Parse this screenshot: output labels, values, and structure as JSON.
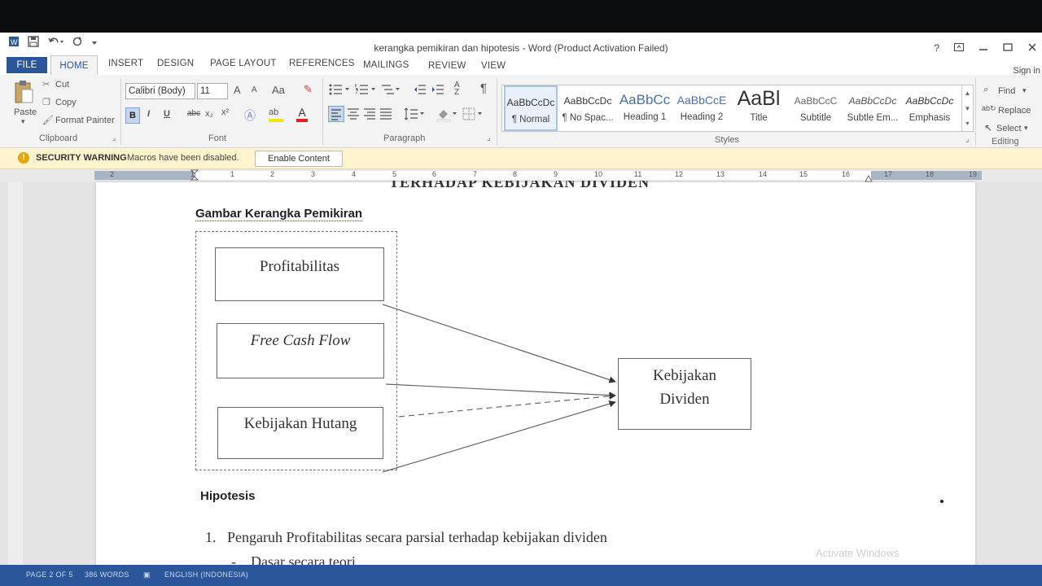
{
  "window": {
    "title": "kerangka pemikiran dan hipotesis - Word (Product Activation Failed)",
    "help": "?",
    "signin": "Sign in"
  },
  "tabs": [
    "FILE",
    "HOME",
    "INSERT",
    "DESIGN",
    "PAGE LAYOUT",
    "REFERENCES",
    "MAILINGS",
    "REVIEW",
    "VIEW"
  ],
  "ribbon": {
    "clipboard": {
      "paste": "Paste",
      "cut": "Cut",
      "copy": "Copy",
      "format_painter": "Format Painter",
      "label": "Clipboard"
    },
    "font": {
      "name": "Calibri (Body)",
      "size": "11",
      "label": "Font",
      "bold": "B",
      "italic": "I",
      "underline": "U",
      "strike": "abc",
      "sub": "x₂",
      "sup": "x²",
      "grow": "A",
      "shrink": "A",
      "case": "Aa"
    },
    "paragraph": {
      "label": "Paragraph",
      "pilcrow": "¶"
    },
    "styles": {
      "label": "Styles",
      "items": [
        {
          "preview": "AaBbCcDc",
          "name": "¶ Normal"
        },
        {
          "preview": "AaBbCcDc",
          "name": "¶ No Spac..."
        },
        {
          "preview": "AaBbCc",
          "name": "Heading 1"
        },
        {
          "preview": "AaBbCcE",
          "name": "Heading 2"
        },
        {
          "preview": "AaBl",
          "name": "Title"
        },
        {
          "preview": "AaBbCcC",
          "name": "Subtitle"
        },
        {
          "preview": "AaBbCcDc",
          "name": "Subtle Em..."
        },
        {
          "preview": "AaBbCcDc",
          "name": "Emphasis"
        }
      ]
    },
    "editing": {
      "find": "Find",
      "replace": "Replace",
      "select": "Select",
      "label": "Editing"
    }
  },
  "security": {
    "title": "SECURITY WARNING",
    "message": "Macros have been disabled.",
    "button": "Enable Content"
  },
  "ruler": [
    "2",
    "1",
    "1",
    "2",
    "3",
    "4",
    "5",
    "6",
    "7",
    "8",
    "9",
    "10",
    "11",
    "12",
    "13",
    "14",
    "15",
    "16",
    "17",
    "18",
    "19"
  ],
  "document": {
    "cutoff_heading": "TERHADAP KEBIJAKAN DIVIDEN",
    "figure_title": "Gambar Kerangka Pemikiran",
    "boxes": {
      "profitabilitas": "Profitabilitas",
      "free_cash_flow": "Free Cash Flow",
      "kebijakan_hutang": "Kebijakan Hutang",
      "kebijakan_dividen_1": "Kebijakan",
      "kebijakan_dividen_2": "Dividen"
    },
    "hipotesis_heading": "Hipotesis",
    "list_number": "1.",
    "list_item_1": "Pengaruh Profitabilitas secara parsial terhadap kebijakan dividen",
    "bullet": "-",
    "list_item_2": "Dasar secara teori",
    "watermark": "Activate Windows"
  },
  "statusbar": {
    "page": "PAGE 2 OF 5",
    "words": "386 WORDS",
    "language": "ENGLISH (INDONESIA)"
  },
  "colors": {
    "accent": "#2b579a",
    "warning_bar": "#fff4ce"
  }
}
